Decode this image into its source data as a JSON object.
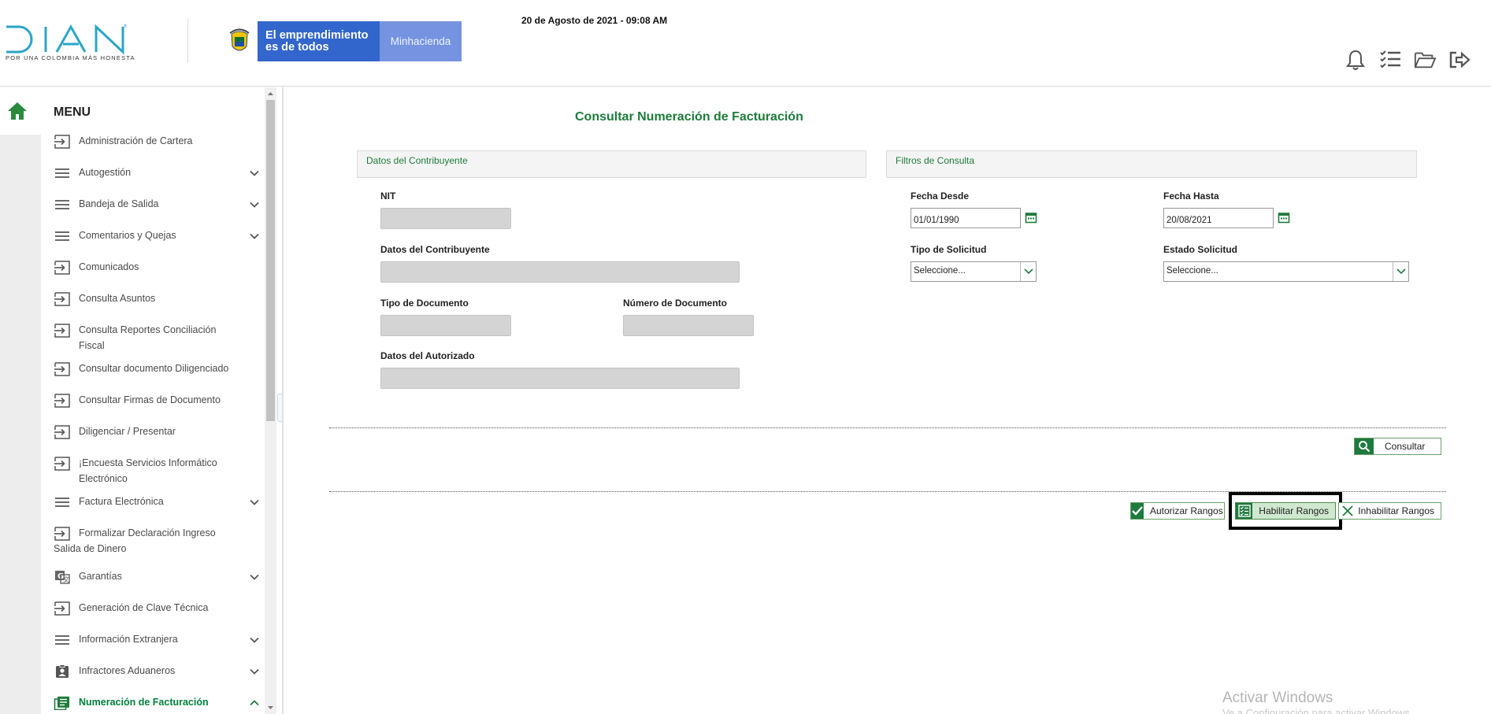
{
  "header": {
    "logo_text": "DIAN",
    "logo_tagline": "POR UNA COLOMBIA MÁS HONESTA",
    "gov_slogan_line1": "El emprendimiento",
    "gov_slogan_line2": "es de todos",
    "gov_ministry": "Minhacienda",
    "datetime": "20 de Agosto de 2021 - 09:08 AM",
    "icons": [
      "bell-icon",
      "task-list-icon",
      "folder-open-icon",
      "logout-icon"
    ]
  },
  "sidebar": {
    "title": "MENU",
    "items": [
      {
        "label": "Administración de Cartera",
        "icon": "enter-icon",
        "chevron": ""
      },
      {
        "label": "Autogestión",
        "icon": "menu-lines-icon",
        "chevron": "down"
      },
      {
        "label": "Bandeja de Salida",
        "icon": "menu-lines-icon",
        "chevron": "down"
      },
      {
        "label": "Comentarios y Quejas",
        "icon": "menu-lines-icon",
        "chevron": "down"
      },
      {
        "label": "Comunicados",
        "icon": "enter-icon",
        "chevron": ""
      },
      {
        "label": "Consulta Asuntos",
        "icon": "enter-icon",
        "chevron": ""
      },
      {
        "label": "Consulta Reportes Conciliación Fiscal",
        "icon": "enter-icon",
        "chevron": ""
      },
      {
        "label": "Consultar documento Diligenciado",
        "icon": "enter-icon",
        "chevron": ""
      },
      {
        "label": "Consultar Firmas de Documento",
        "icon": "enter-icon",
        "chevron": ""
      },
      {
        "label": "Diligenciar / Presentar",
        "icon": "enter-icon",
        "chevron": ""
      },
      {
        "label": "¡Encuesta Servicios Informático Electrónico",
        "icon": "enter-icon",
        "chevron": ""
      },
      {
        "label": "Factura Electrónica",
        "icon": "menu-lines-icon",
        "chevron": "down"
      },
      {
        "label": "Formalizar Declaración Ingreso Salida de Dinero",
        "icon": "enter-icon",
        "chevron": ""
      },
      {
        "label": "Garantías",
        "icon": "translate-icon",
        "chevron": "down"
      },
      {
        "label": "Generación de Clave Técnica",
        "icon": "enter-icon",
        "chevron": ""
      },
      {
        "label": "Información Extranjera",
        "icon": "menu-lines-icon",
        "chevron": "down"
      },
      {
        "label": "Infractores Aduaneros",
        "icon": "badge-icon",
        "chevron": "down"
      },
      {
        "label": "Numeración de Facturación",
        "icon": "document-list-icon",
        "chevron": "up"
      }
    ]
  },
  "main": {
    "title": "Consultar Numeración de Facturación",
    "section_contribuyente": "Datos del Contribuyente",
    "section_filtros": "Filtros de Consulta",
    "labels": {
      "nit": "NIT",
      "datos_contribuyente": "Datos del Contribuyente",
      "tipo_documento": "Tipo de Documento",
      "numero_documento": "Número de Documento",
      "datos_autorizado": "Datos del Autorizado",
      "fecha_desde": "Fecha Desde",
      "fecha_hasta": "Fecha Hasta",
      "tipo_solicitud": "Tipo de Solicitud",
      "estado_solicitud": "Estado Solicitud"
    },
    "values": {
      "fecha_desde": "01/01/1990",
      "fecha_hasta": "20/08/2021",
      "tipo_solicitud": "Seleccione...",
      "estado_solicitud": "Seleccione..."
    },
    "buttons": {
      "consultar": "Consultar",
      "autorizar": "Autorizar Rangos",
      "habilitar": "Habilitar Rangos",
      "inhabilitar": "Inhabilitar Rangos"
    }
  },
  "watermark": {
    "line1": "Activar Windows",
    "line2": "Ve a Configuración para activar Windows."
  },
  "colors": {
    "brand_green": "#1e7b3b",
    "dian_blue": "#2aa5c8",
    "gov_blue": "#3366cc"
  }
}
